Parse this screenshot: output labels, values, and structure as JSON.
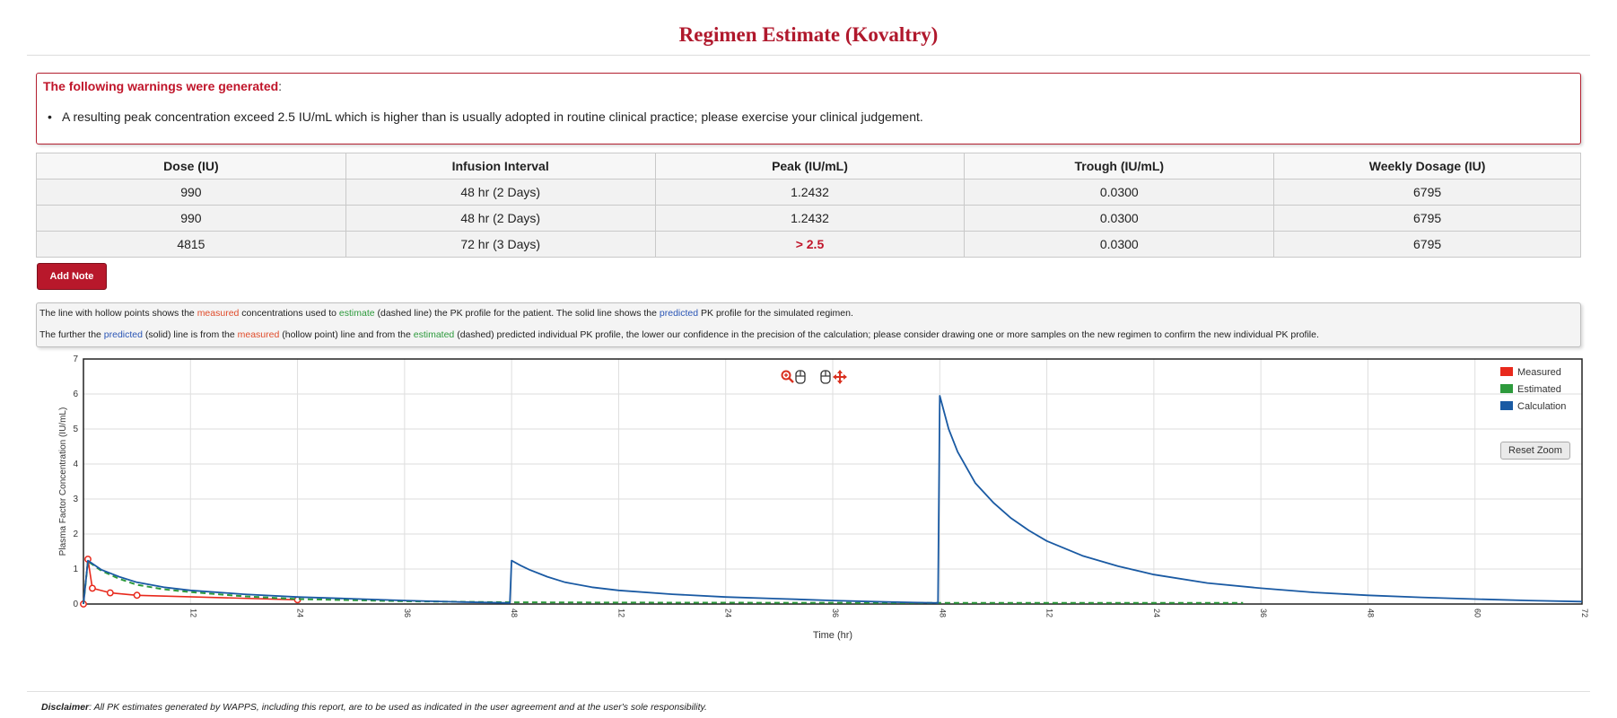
{
  "page": {
    "title": "Regimen Estimate (Kovaltry)"
  },
  "warnings": {
    "heading": "The following warnings were generated",
    "heading_suffix": ":",
    "items": [
      "A resulting peak concentration exceed 2.5 IU/mL which is higher than is usually adopted in routine clinical practice; please exercise your clinical judgement."
    ]
  },
  "regimen_table": {
    "headers": [
      "Dose (IU)",
      "Infusion Interval",
      "Peak (IU/mL)",
      "Trough (IU/mL)",
      "Weekly Dosage (IU)"
    ],
    "rows": [
      [
        "990",
        "48 hr (2 Days)",
        "1.2432",
        "0.0300",
        "6795"
      ],
      [
        "990",
        "48 hr (2 Days)",
        "1.2432",
        "0.0300",
        "6795"
      ],
      [
        "4815",
        "72 hr (3 Days)",
        "> 2.5",
        "0.0300",
        "6795"
      ]
    ],
    "alert_color": "#c0152a"
  },
  "add_note_label": "Add Note",
  "info": {
    "line1": {
      "a": "The line with hollow points shows the ",
      "measured": "measured",
      "b": " concentrations used to ",
      "estimate": "estimate",
      "c": " (dashed line) the PK profile for the patient. The solid line shows the ",
      "predicted": "predicted",
      "d": " PK profile for the simulated regimen."
    },
    "line2": {
      "a": "The further the ",
      "predicted": "predicted",
      "b": " (solid) line is from the ",
      "measured": "measured",
      "c": " (hollow point) line and from the ",
      "estimated": "estimated",
      "d": " (dashed) predicted individual PK profile, the lower our confidence in the precision of the calculation; please consider drawing one or more samples on the new regimen to confirm the new individual PK profile."
    }
  },
  "chart_toolbar": {
    "icons": [
      "zoom-in-icon",
      "mouse-icon",
      "mouse-icon",
      "pan-icon"
    ]
  },
  "reset_zoom_label": "Reset Zoom",
  "chart_data": {
    "type": "line",
    "xlabel": "Time (hr)",
    "ylabel": "Plasma Factor Concentration (IU/mL)",
    "xlim": [
      0,
      168
    ],
    "ylim": [
      0,
      7
    ],
    "y_ticks": [
      0,
      1,
      2,
      3,
      4,
      5,
      6,
      7
    ],
    "x_ticks": [
      {
        "x": 12,
        "label": "12"
      },
      {
        "x": 24,
        "label": "24"
      },
      {
        "x": 36,
        "label": "36"
      },
      {
        "x": 48,
        "label": "48"
      },
      {
        "x": 60,
        "label": "12"
      },
      {
        "x": 72,
        "label": "24"
      },
      {
        "x": 84,
        "label": "36"
      },
      {
        "x": 96,
        "label": "48"
      },
      {
        "x": 108,
        "label": "12"
      },
      {
        "x": 120,
        "label": "24"
      },
      {
        "x": 132,
        "label": "36"
      },
      {
        "x": 144,
        "label": "48"
      },
      {
        "x": 156,
        "label": "60"
      },
      {
        "x": 168,
        "label": "72"
      }
    ],
    "grid": true,
    "legend_position": "top-right",
    "series": [
      {
        "name": "Measured",
        "color": "#e8291c",
        "style": "solid-with-hollow-points",
        "points": [
          [
            0,
            0
          ],
          [
            0.5,
            1.28
          ],
          [
            1,
            0.45
          ],
          [
            3,
            0.32
          ],
          [
            6,
            0.25
          ],
          [
            24,
            0.12
          ]
        ]
      },
      {
        "name": "Estimated",
        "color": "#2d9a3c",
        "style": "dashed",
        "points": [
          [
            0,
            0
          ],
          [
            0.5,
            1.22
          ],
          [
            2,
            0.95
          ],
          [
            4,
            0.72
          ],
          [
            6,
            0.55
          ],
          [
            9,
            0.42
          ],
          [
            12,
            0.34
          ],
          [
            18,
            0.22
          ],
          [
            24,
            0.14
          ],
          [
            36,
            0.08
          ],
          [
            48,
            0.05
          ],
          [
            60,
            0.04
          ],
          [
            96,
            0.03
          ],
          [
            130,
            0.03
          ]
        ]
      },
      {
        "name": "Calculation",
        "color": "#1a5aa3",
        "style": "solid",
        "points": [
          [
            0,
            0
          ],
          [
            0.5,
            1.24
          ],
          [
            2,
            0.98
          ],
          [
            4,
            0.78
          ],
          [
            6,
            0.62
          ],
          [
            9,
            0.48
          ],
          [
            12,
            0.39
          ],
          [
            18,
            0.28
          ],
          [
            24,
            0.2
          ],
          [
            30,
            0.15
          ],
          [
            36,
            0.1
          ],
          [
            42,
            0.06
          ],
          [
            47.8,
            0.03
          ],
          [
            48,
            1.24
          ],
          [
            49,
            1.1
          ],
          [
            50,
            0.98
          ],
          [
            52,
            0.78
          ],
          [
            54,
            0.62
          ],
          [
            57,
            0.48
          ],
          [
            60,
            0.39
          ],
          [
            66,
            0.28
          ],
          [
            72,
            0.2
          ],
          [
            78,
            0.15
          ],
          [
            84,
            0.1
          ],
          [
            90,
            0.06
          ],
          [
            95.8,
            0.03
          ],
          [
            96,
            5.95
          ],
          [
            97,
            5.0
          ],
          [
            98,
            4.35
          ],
          [
            100,
            3.45
          ],
          [
            102,
            2.9
          ],
          [
            104,
            2.45
          ],
          [
            106,
            2.1
          ],
          [
            108,
            1.8
          ],
          [
            112,
            1.38
          ],
          [
            116,
            1.08
          ],
          [
            120,
            0.84
          ],
          [
            126,
            0.6
          ],
          [
            132,
            0.45
          ],
          [
            138,
            0.33
          ],
          [
            144,
            0.25
          ],
          [
            150,
            0.19
          ],
          [
            156,
            0.14
          ],
          [
            162,
            0.1
          ],
          [
            168,
            0.07
          ]
        ]
      }
    ]
  },
  "disclaimer": {
    "label": "Disclaimer",
    "text": ": All PK estimates generated by WAPPS, including this report, are to be used as indicated in the user agreement and at the user's sole responsibility."
  }
}
